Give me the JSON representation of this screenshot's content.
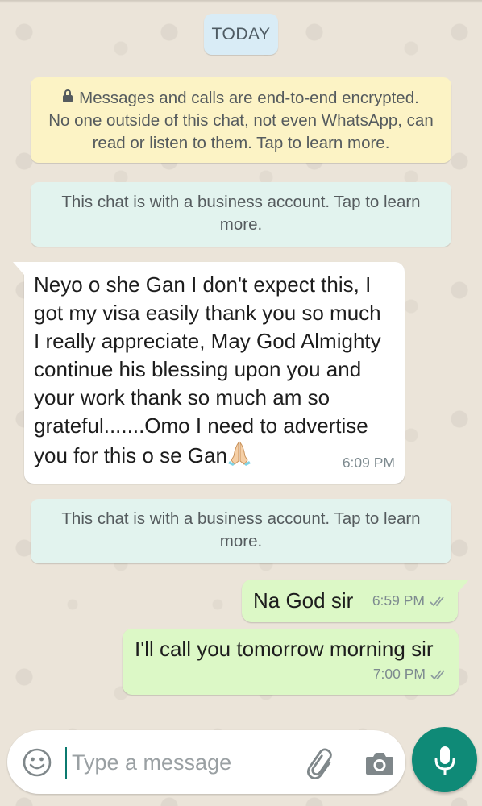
{
  "date_divider": "TODAY",
  "notices": {
    "encryption_line1": "Messages and calls are end-to-end encrypted.",
    "encryption_line2": "No one outside of this chat, not even WhatsApp, can",
    "encryption_line3": "read or listen to them. Tap to learn more.",
    "business_line1": "This chat is with a business account. Tap to learn",
    "business_line2": "more."
  },
  "messages": [
    {
      "direction": "incoming",
      "lines": [
        "Neyo o she Gan I don't expect this, I",
        "got my visa easily thank you so much",
        "I really appreciate, May God Almighty",
        "continue his blessing upon you and",
        "your work thank so much am so",
        "grateful.......Omo I need to advertise",
        "you for this o se Gan"
      ],
      "emoji": "folded-hands",
      "time": "6:09 PM"
    },
    {
      "direction": "outgoing",
      "text": "Na God sir",
      "time": "6:59 PM",
      "status": "read"
    },
    {
      "direction": "outgoing",
      "text": "I'll call you tomorrow morning sir",
      "time": "7:00 PM",
      "status": "read"
    }
  ],
  "composer": {
    "placeholder": "Type a message"
  },
  "colors": {
    "wallpaper": "#ece5dd",
    "outgoing_bubble": "#dcf8c6",
    "incoming_bubble": "#ffffff",
    "encryption_notice": "#fcf3c5",
    "business_notice": "#e2f3ee",
    "date_chip": "#d9ecf6",
    "mic_button": "#0f8a77"
  },
  "icons": [
    "lock-icon",
    "double-check-icon",
    "emoji-icon",
    "paperclip-icon",
    "camera-icon",
    "microphone-icon"
  ]
}
